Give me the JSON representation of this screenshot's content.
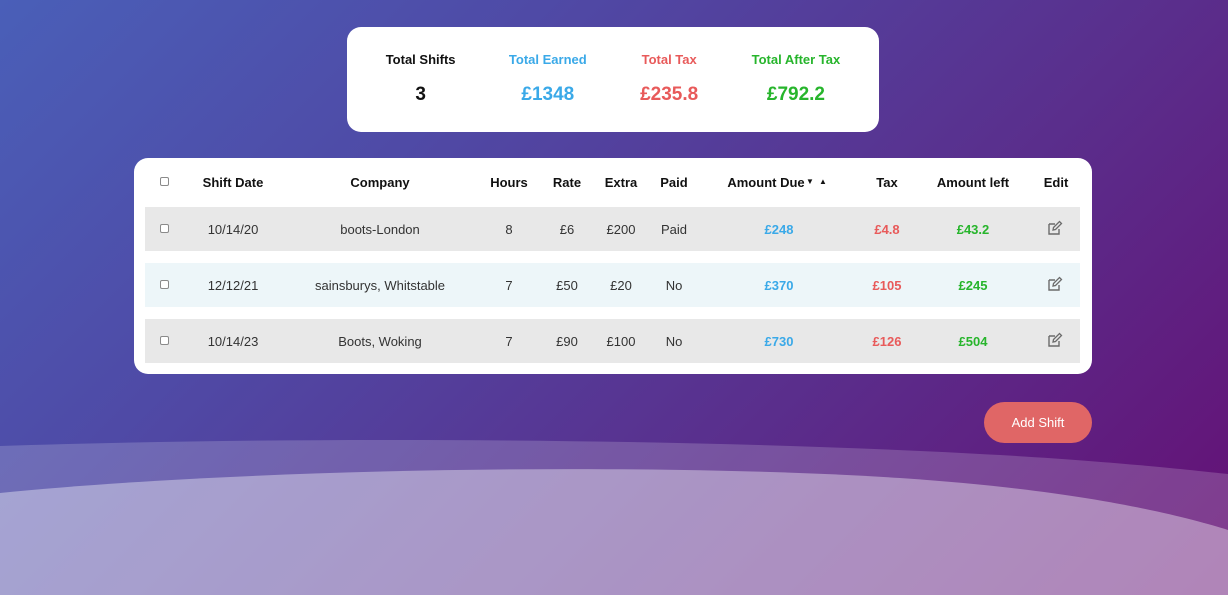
{
  "summary": {
    "total_shifts_label": "Total Shifts",
    "total_shifts_value": "3",
    "total_earned_label": "Total Earned",
    "total_earned_value": "£1348",
    "total_tax_label": "Total Tax",
    "total_tax_value": "£235.8",
    "total_after_tax_label": "Total After Tax",
    "total_after_tax_value": "£792.2"
  },
  "table": {
    "headers": {
      "shift_date": "Shift Date",
      "company": "Company",
      "hours": "Hours",
      "rate": "Rate",
      "extra": "Extra",
      "paid": "Paid",
      "amount_due": "Amount Due",
      "tax": "Tax",
      "amount_left": "Amount left",
      "edit": "Edit"
    },
    "sort_icons": [
      "▼",
      "▲"
    ],
    "rows": [
      {
        "date": "10/14/20",
        "company": "boots-London",
        "hours": "8",
        "rate": "£6",
        "extra": "£200",
        "paid": "Paid",
        "amount_due": "£248",
        "tax": "£4.8",
        "amount_left": "£43.2"
      },
      {
        "date": "12/12/21",
        "company": "sainsburys, Whitstable",
        "hours": "7",
        "rate": "£50",
        "extra": "£20",
        "paid": "No",
        "amount_due": "£370",
        "tax": "£105",
        "amount_left": "£245"
      },
      {
        "date": "10/14/23",
        "company": "Boots, Woking",
        "hours": "7",
        "rate": "£90",
        "extra": "£100",
        "paid": "No",
        "amount_due": "£730",
        "tax": "£126",
        "amount_left": "£504"
      }
    ]
  },
  "add_button_label": "Add Shift",
  "icons": {
    "edit": "edit-icon",
    "checkbox": "checkbox-icon"
  },
  "colors": {
    "earned": "#3aa9e8",
    "tax": "#e85a5a",
    "after_tax": "#27b52c",
    "button": "#e06666",
    "row_odd": "#e8e8e8",
    "row_even": "#edf6f9"
  }
}
